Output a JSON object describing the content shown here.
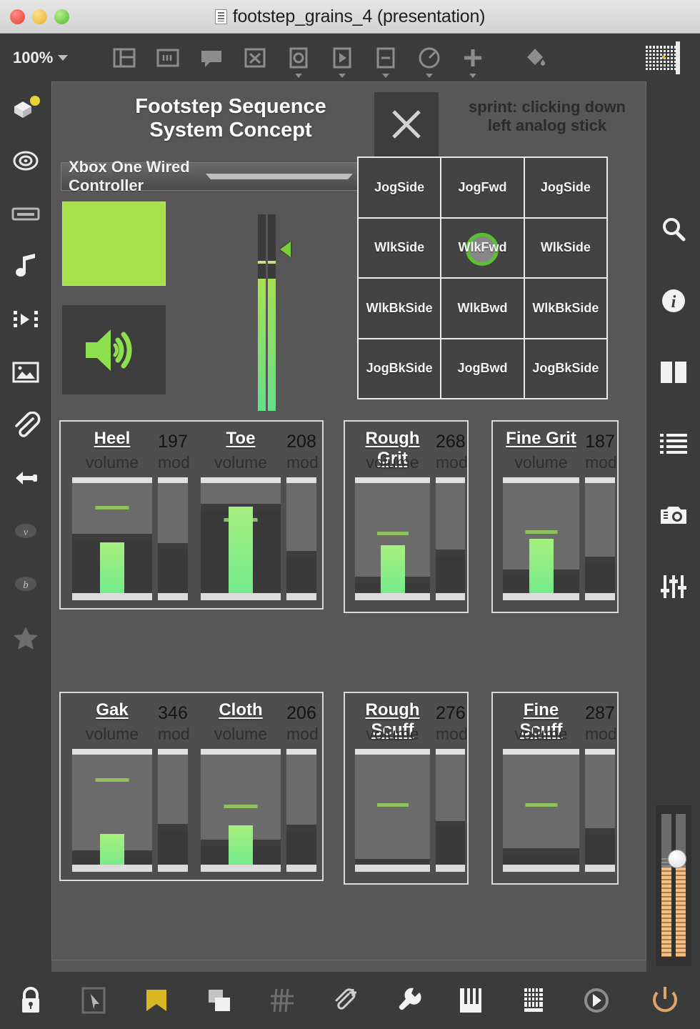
{
  "window": {
    "title": "footstep_grains_4 (presentation)",
    "doc_icon": "document-icon",
    "close_label": "close",
    "minimize_label": "minimize",
    "zoom_label": "zoom"
  },
  "toolbar": {
    "zoom_value": "100%",
    "items": [
      {
        "name": "layout-icon",
        "label": "Layout"
      },
      {
        "name": "text-box-icon",
        "label": "Text"
      },
      {
        "name": "comment-icon",
        "label": "Comment"
      },
      {
        "name": "close-object-icon",
        "label": "Close"
      },
      {
        "name": "record-icon",
        "label": "Record"
      },
      {
        "name": "play-icon",
        "label": "Play"
      },
      {
        "name": "remove-icon",
        "label": "Remove"
      },
      {
        "name": "gauge-icon",
        "label": "Meter"
      },
      {
        "name": "add-icon",
        "label": "Add"
      },
      {
        "name": "paint-bucket-icon",
        "label": "Fill"
      },
      {
        "name": "grid-pattern-icon",
        "label": "Pattern"
      }
    ]
  },
  "rail_left": {
    "items": [
      {
        "name": "package-icon",
        "label": "Package"
      },
      {
        "name": "target-icon",
        "label": "Target"
      },
      {
        "name": "keyboard-icon",
        "label": "Keyboard"
      },
      {
        "name": "music-note-icon",
        "label": "Music"
      },
      {
        "name": "sequencer-icon",
        "label": "Sequencer"
      },
      {
        "name": "image-icon",
        "label": "Image"
      },
      {
        "name": "paperclip-icon",
        "label": "Attachment"
      },
      {
        "name": "plug-icon",
        "label": "Plugin"
      },
      {
        "name": "v-badge-icon",
        "label": "V"
      },
      {
        "name": "b-badge-icon",
        "label": "B"
      },
      {
        "name": "star-icon",
        "label": "Favorite"
      }
    ]
  },
  "rail_right": {
    "items": [
      {
        "name": "search-icon",
        "label": "Search"
      },
      {
        "name": "info-icon",
        "label": "Info"
      },
      {
        "name": "split-view-icon",
        "label": "Split View"
      },
      {
        "name": "list-icon",
        "label": "List"
      },
      {
        "name": "camera-icon",
        "label": "Snapshot"
      },
      {
        "name": "sliders-icon",
        "label": "Mixer"
      }
    ],
    "master_fader": {
      "name": "master-fader",
      "label": "Master"
    }
  },
  "bottombar": {
    "items": [
      {
        "name": "lock-icon",
        "label": "Lock",
        "active": false
      },
      {
        "name": "select-cursor-icon",
        "label": "Select",
        "active": false
      },
      {
        "name": "bookmark-icon",
        "label": "Bookmark",
        "active": true
      },
      {
        "name": "duplicate-icon",
        "label": "Duplicate",
        "active": false
      },
      {
        "name": "grid-icon",
        "label": "Grid",
        "active": false
      },
      {
        "name": "attach-add-icon",
        "label": "Add Attachment",
        "active": false
      },
      {
        "name": "wrench-icon",
        "label": "Tools",
        "active": false
      },
      {
        "name": "piano-icon",
        "label": "Piano",
        "active": false
      },
      {
        "name": "keyboard-map-icon",
        "label": "Key Map",
        "active": false
      },
      {
        "name": "transport-icon",
        "label": "Transport",
        "active": false
      }
    ],
    "power": {
      "name": "power-icon",
      "label": "Power"
    }
  },
  "canvas": {
    "header": {
      "title_line1": "Footstep Sequence",
      "title_line2": "System Concept",
      "close_button": "✕",
      "hint_line1": "sprint: clicking down",
      "hint_line2": "left analog stick"
    },
    "controller_select": {
      "value": "Xbox One Wired Controller",
      "options": [
        "Xbox One Wired Controller"
      ]
    },
    "color_swatch": {
      "hex": "#a8e04e"
    },
    "speaker_button": {
      "name": "speaker-icon",
      "label": "Audio On"
    },
    "mini_meter": {
      "label": "signal-meter",
      "level_pct": 67
    },
    "state_grid": {
      "rows": [
        [
          "JogSide",
          "JogFwd",
          "JogSide"
        ],
        [
          "WlkSide",
          "WlkFwd",
          "WlkSide"
        ],
        [
          "WlkBkSide",
          "WlkBwd",
          "WlkBkSide"
        ],
        [
          "JogBkSide",
          "JogBwd",
          "JogBkSide"
        ]
      ],
      "active": {
        "row": 1,
        "col": 1,
        "label": "WlkFwd"
      }
    },
    "groups": [
      {
        "name": "group-heel-toe",
        "strips": [
          {
            "name": "Heel",
            "volume_label": "volume",
            "mod_label": "mod",
            "mod_value": "197",
            "volume_bar_pct": 47,
            "volume_mark_pct": 74,
            "volume_dark_pct": 49,
            "mod_bar_pct": 41
          },
          {
            "name": "Toe",
            "volume_label": "volume",
            "mod_label": "mod",
            "mod_value": "208",
            "volume_bar_pct": 76,
            "volume_mark_pct": 64,
            "volume_dark_pct": 73,
            "mod_bar_pct": 35
          }
        ]
      },
      {
        "name": "group-gak-cloth",
        "strips": [
          {
            "name": "Gak",
            "volume_label": "volume",
            "mod_label": "mod",
            "mod_value": "346",
            "volume_bar_pct": 31,
            "volume_mark_pct": 73,
            "volume_dark_pct": 12,
            "mod_bar_pct": 34
          },
          {
            "name": "Cloth",
            "volume_label": "volume",
            "mod_label": "mod",
            "mod_value": "206",
            "volume_bar_pct": 38,
            "volume_mark_pct": 52,
            "volume_dark_pct": 21,
            "mod_bar_pct": 33
          }
        ]
      },
      {
        "name": "group-rough-grit",
        "strips": [
          {
            "name": "Rough Grit",
            "volume_label": "volume",
            "mod_label": "mod",
            "mod_value": "268",
            "volume_bar_pct": 45,
            "volume_mark_pct": 53,
            "volume_dark_pct": 14,
            "mod_bar_pct": 36
          }
        ]
      },
      {
        "name": "group-fine-grit",
        "strips": [
          {
            "name": "Fine Grit",
            "volume_label": "volume",
            "mod_label": "mod",
            "mod_value": "187",
            "volume_bar_pct": 50,
            "volume_mark_pct": 54,
            "volume_dark_pct": 20,
            "mod_bar_pct": 30
          }
        ]
      },
      {
        "name": "group-rough-scuff",
        "strips": [
          {
            "name": "Rough Scuff",
            "volume_label": "volume",
            "mod_label": "mod",
            "mod_value": "276",
            "volume_bar_pct": 0,
            "volume_mark_pct": 53,
            "volume_dark_pct": 5,
            "mod_bar_pct": 36
          }
        ]
      },
      {
        "name": "group-fine-scuff",
        "strips": [
          {
            "name": "Fine Scuff",
            "volume_label": "volume",
            "mod_label": "mod",
            "mod_value": "287",
            "volume_bar_pct": 0,
            "volume_mark_pct": 53,
            "volume_dark_pct": 14,
            "mod_bar_pct": 30
          }
        ]
      }
    ]
  },
  "colors": {
    "accent_green": "#7ae06a",
    "swatch_green": "#a8e04e",
    "panel_bg": "#575757",
    "chrome_bg": "#3b3b3b",
    "group_bg": "#4e4e4e",
    "bookmark_yellow": "#d8b723",
    "power_orange": "#e0a46a"
  }
}
